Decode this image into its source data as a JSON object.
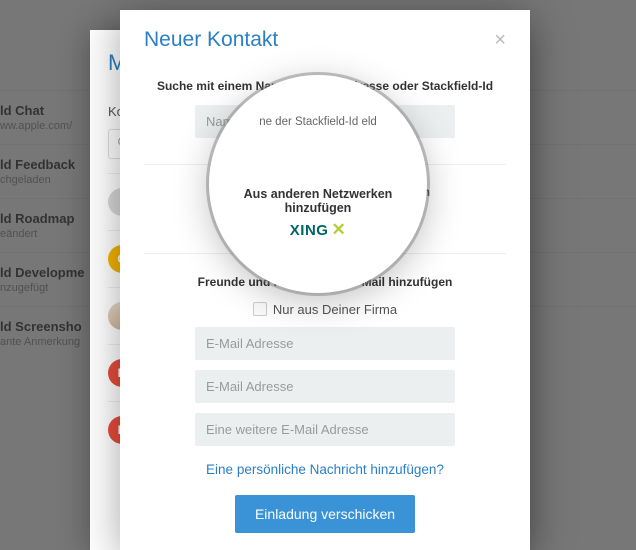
{
  "background": {
    "items": [
      {
        "title": "ld Chat",
        "subtitle": "ww.apple.com/"
      },
      {
        "title": "ld Feedback",
        "subtitle": "chgeladen"
      },
      {
        "title": "ld Roadmap",
        "subtitle": "eändert"
      },
      {
        "title": "ld Developme",
        "subtitle": "nzugefügt"
      },
      {
        "title": "ld Screensho",
        "subtitle": "ante Anmerkung"
      }
    ]
  },
  "underModal": {
    "titleFragment": "Me",
    "subLabel": "Kon",
    "searchIcon": "search-icon",
    "avatarLetters": {
      "yellow": "G",
      "red1": "D",
      "red2": "D"
    }
  },
  "modal": {
    "title": "Neuer Kontakt",
    "closeGlyph": "×",
    "searchSection": {
      "label": "Suche mit einem Namen, E-Mail-Adresse oder Stackfield-Id",
      "placeholder": "Name, E-Mail oder Stackfield-Id"
    },
    "networkSection": {
      "label": "Aus anderen Netzwerken hinzufügen",
      "xingWord": "XING",
      "xingMark": "✕"
    },
    "inviteSection": {
      "label": "Freunde und Kollegen per E-Mail hinzufügen",
      "checkboxLabel": "Nur aus Deiner Firma",
      "email1Placeholder": "E-Mail Adresse",
      "email2Placeholder": "E-Mail Adresse",
      "email3Placeholder": "Eine weitere E-Mail Adresse",
      "addMessageLink": "Eine persönliche Nachricht hinzufügen?",
      "sendButton": "Einladung verschicken"
    }
  },
  "spotlight": {
    "line1a": "ne der Stackfield-Id      eld",
    "netLabel": "Aus anderen Netzwerken hinzufügen"
  },
  "colors": {
    "accent": "#2b7fc4",
    "buttonBg": "#3a93d6",
    "xingGreen": "#006567",
    "xingLime": "#b2d035"
  }
}
